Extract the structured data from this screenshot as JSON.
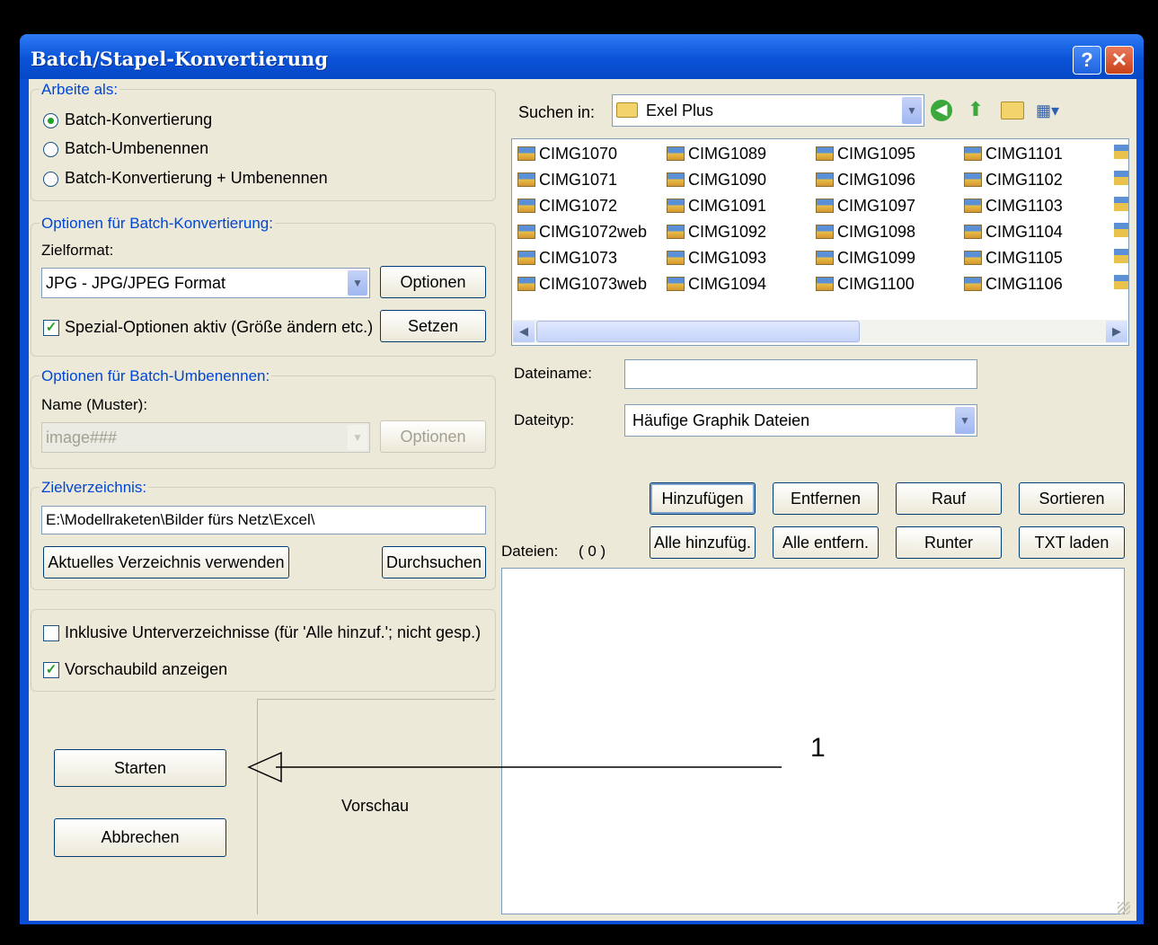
{
  "window": {
    "title": "Batch/Stapel-Konvertierung",
    "help_glyph": "?",
    "close_glyph": "✕"
  },
  "work_as": {
    "label": "Arbeite als:",
    "options": [
      "Batch-Konvertierung",
      "Batch-Umbenennen",
      "Batch-Konvertierung + Umbenennen"
    ],
    "selected": 0
  },
  "convert_options": {
    "label": "Optionen für Batch-Konvertierung:",
    "target_format_label": "Zielformat:",
    "target_format_value": "JPG - JPG/JPEG Format",
    "options_button": "Optionen",
    "special_label": "Spezial-Optionen aktiv (Größe ändern etc.)",
    "special_checked": true,
    "set_button": "Setzen"
  },
  "rename_options": {
    "label": "Optionen für Batch-Umbenennen:",
    "name_label": "Name (Muster):",
    "name_value": "image###",
    "options_button": "Optionen"
  },
  "target_dir": {
    "label": "Zielverzeichnis:",
    "path": "E:\\Modellraketen\\Bilder fürs Netz\\Excel\\",
    "use_current_button": "Aktuelles Verzeichnis verwenden",
    "browse_button": "Durchsuchen"
  },
  "misc": {
    "subdirs_label": "Inklusive Unterverzeichnisse (für 'Alle hinzuf.'; nicht gesp.)",
    "subdirs_checked": false,
    "preview_label": "Vorschaubild anzeigen",
    "preview_checked": true
  },
  "actions": {
    "start": "Starten",
    "cancel": "Abbrechen"
  },
  "preview": {
    "label": "Vorschau"
  },
  "annotation": {
    "number": "1"
  },
  "browser": {
    "look_in_label": "Suchen in:",
    "look_in_value": "Exel Plus",
    "files": [
      [
        "CIMG1070",
        "CIMG1071",
        "CIMG1072",
        "CIMG1072web",
        "CIMG1073",
        "CIMG1073web"
      ],
      [
        "CIMG1089",
        "CIMG1090",
        "CIMG1091",
        "CIMG1092",
        "CIMG1093",
        "CIMG1094"
      ],
      [
        "CIMG1095",
        "CIMG1096",
        "CIMG1097",
        "CIMG1098",
        "CIMG1099",
        "CIMG1100"
      ],
      [
        "CIMG1101",
        "CIMG1102",
        "CIMG1103",
        "CIMG1104",
        "CIMG1105",
        "CIMG1106"
      ]
    ],
    "filename_label": "Dateiname:",
    "filename_value": "",
    "filetype_label": "Dateityp:",
    "filetype_value": "Häufige Graphik Dateien"
  },
  "list_buttons": {
    "add": "Hinzufügen",
    "remove": "Entfernen",
    "up": "Rauf",
    "sort": "Sortieren",
    "add_all": "Alle hinzufüg.",
    "remove_all": "Alle entfern.",
    "down": "Runter",
    "load_txt": "TXT laden"
  },
  "files_list": {
    "label": "Dateien:",
    "count": "( 0 )"
  },
  "colors": {
    "titlebar": "#0a53d8",
    "dialog_bg": "#ece9d8",
    "group_label": "#0046d5",
    "check": "#21a121"
  }
}
